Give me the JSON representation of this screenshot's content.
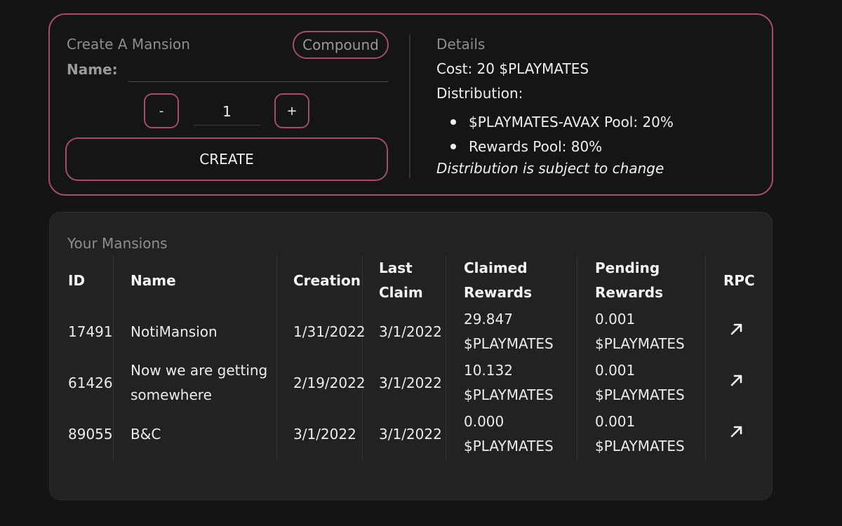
{
  "create": {
    "title": "Create A Mansion",
    "compound_label": "Compound",
    "name_label": "Name:",
    "name_value": "",
    "minus_label": "-",
    "quantity": "1",
    "plus_label": "+",
    "create_label": "CREATE"
  },
  "details": {
    "title": "Details",
    "cost": "Cost: 20 $PLAYMATES",
    "distribution_label": "Distribution:",
    "items": [
      "$PLAYMATES-AVAX Pool: 20%",
      "Rewards Pool: 80%"
    ],
    "note": "Distribution is subject to change"
  },
  "mansions": {
    "title": "Your Mansions",
    "headers": {
      "id": "ID",
      "name": "Name",
      "creation": "Creation",
      "last_claim_1": "Last",
      "last_claim_2": "Claim",
      "claimed_1": "Claimed",
      "claimed_2": "Rewards",
      "pending_1": "Pending",
      "pending_2": "Rewards",
      "rpc": "RPC"
    },
    "rows": [
      {
        "id": "17491",
        "name_1": "NotiMansion",
        "name_2": "",
        "creation": "1/31/2022",
        "last_claim": "3/1/2022",
        "claimed_value": "29.847",
        "claimed_unit": "$PLAYMATES",
        "pending_value": "0.001",
        "pending_unit": "$PLAYMATES",
        "rpc_icon": "arrow-up-right-icon"
      },
      {
        "id": "61426",
        "name_1": "Now we are getting",
        "name_2": "somewhere",
        "creation": "2/19/2022",
        "last_claim": "3/1/2022",
        "claimed_value": "10.132",
        "claimed_unit": "$PLAYMATES",
        "pending_value": "0.001",
        "pending_unit": "$PLAYMATES",
        "rpc_icon": "arrow-up-right-icon"
      },
      {
        "id": "89055",
        "name_1": "B&C",
        "name_2": "",
        "creation": "3/1/2022",
        "last_claim": "3/1/2022",
        "claimed_value": "0.000",
        "claimed_unit": "$PLAYMATES",
        "pending_value": "0.001",
        "pending_unit": "$PLAYMATES",
        "rpc_icon": "arrow-up-right-icon"
      }
    ]
  },
  "colors": {
    "background": "#141414",
    "accent_border": "#a34c6e",
    "panel": "#222222",
    "text": "#ececec",
    "muted_text": "#8e8e8e"
  }
}
